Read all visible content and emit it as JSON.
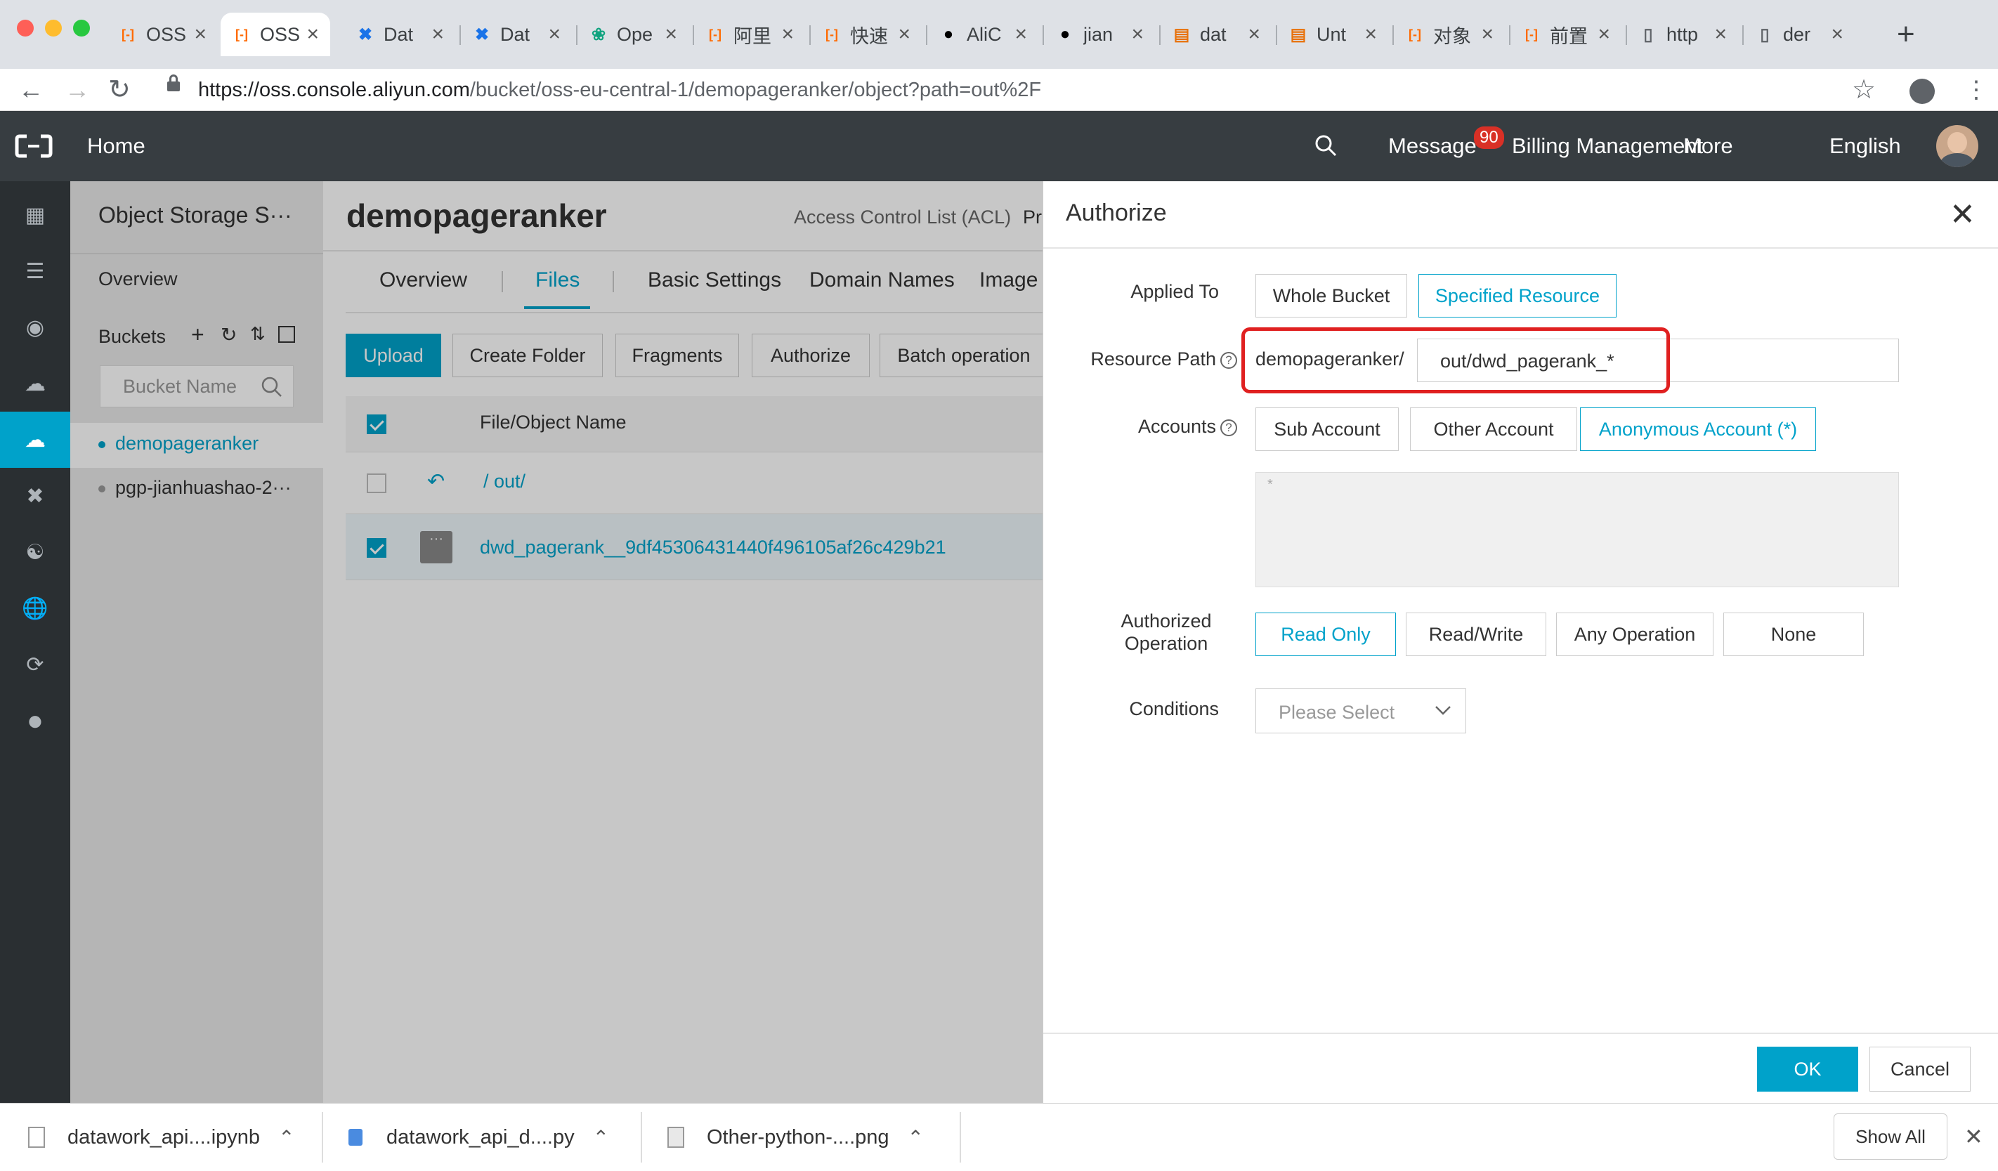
{
  "browser": {
    "tabs": [
      {
        "label": "OSS",
        "icon": "aliyun-icon",
        "color": "#ff6a00"
      },
      {
        "label": "OSS",
        "icon": "aliyun-icon",
        "color": "#ff6a00"
      },
      {
        "label": "Dat",
        "icon": "dataworks-icon",
        "color": "#1a73e8"
      },
      {
        "label": "Dat",
        "icon": "dataworks-icon",
        "color": "#1a73e8"
      },
      {
        "label": "Ope",
        "icon": "openai-icon",
        "color": "#10a37f"
      },
      {
        "label": "阿里",
        "icon": "aliyun-icon",
        "color": "#ff6a00"
      },
      {
        "label": "快速",
        "icon": "aliyun-icon",
        "color": "#ff6a00"
      },
      {
        "label": "AliC",
        "icon": "github-icon",
        "color": "#000000"
      },
      {
        "label": "jian",
        "icon": "github-icon",
        "color": "#000000"
      },
      {
        "label": "dat",
        "icon": "book-icon",
        "color": "#e8710a"
      },
      {
        "label": "Unt",
        "icon": "book-icon",
        "color": "#e8710a"
      },
      {
        "label": "对象",
        "icon": "aliyun-icon",
        "color": "#ff6a00"
      },
      {
        "label": "前置",
        "icon": "aliyun-icon",
        "color": "#ff6a00"
      },
      {
        "label": "http",
        "icon": "file-icon",
        "color": "#5f6368"
      },
      {
        "label": "der",
        "icon": "file-icon",
        "color": "#5f6368"
      }
    ],
    "url_host": "https://oss.console.aliyun.com",
    "url_path": "/bucket/oss-eu-central-1/demopageranker/object?path=out%2F"
  },
  "topnav": {
    "home": "Home",
    "message": "Message",
    "message_count": "90",
    "billing": "Billing Management",
    "more": "More",
    "language": "English"
  },
  "sidebar": {
    "title": "Object Storage S···",
    "overview": "Overview",
    "buckets_label": "Buckets",
    "search_placeholder": "Bucket Name",
    "buckets": [
      "demopageranker",
      "pgp-jianhuashao-2···"
    ]
  },
  "main": {
    "bucket_name": "demopageranker",
    "acl_label": "Access Control List (ACL)",
    "acl_value": "Pr",
    "tabs": [
      "Overview",
      "Files",
      "Basic Settings",
      "Domain Names",
      "Image"
    ],
    "actions": {
      "upload": "Upload",
      "create_folder": "Create Folder",
      "fragments": "Fragments",
      "authorize": "Authorize",
      "batch": "Batch operation"
    },
    "table_header": "File/Object Name",
    "parent_path": "out/",
    "file_name": "dwd_pagerank__9df45306431440f496105af26c429b21"
  },
  "dialog": {
    "title": "Authorize",
    "applied_to_label": "Applied To",
    "applied_to_options": [
      "Whole Bucket",
      "Specified Resource"
    ],
    "resource_path_label": "Resource Path",
    "resource_prefix": "demopageranker/",
    "resource_value": "out/dwd_pagerank_*",
    "accounts_label": "Accounts",
    "accounts_options": [
      "Sub Account",
      "Other Account",
      "Anonymous Account (*)"
    ],
    "accounts_box_value": "*",
    "operation_label_line1": "Authorized",
    "operation_label_line2": "Operation",
    "operation_options": [
      "Read Only",
      "Read/Write",
      "Any Operation",
      "None"
    ],
    "conditions_label": "Conditions",
    "conditions_placeholder": "Please Select",
    "ok": "OK",
    "cancel": "Cancel",
    "highlight_color": "#e02020",
    "accent_color": "#00a2ca"
  },
  "downloads": {
    "items": [
      "datawork_api....ipynb",
      "datawork_api_d....py",
      "Other-python-....png"
    ],
    "show_all": "Show All"
  }
}
